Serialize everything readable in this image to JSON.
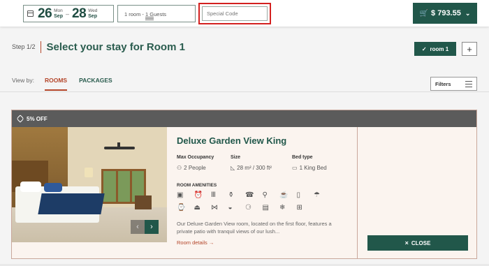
{
  "dates": {
    "checkin_day": "26",
    "checkin_weekday": "Mon",
    "checkin_month": "Sep",
    "separator": "–",
    "checkout_day": "28",
    "checkout_weekday": "Wed",
    "checkout_month": "Sep"
  },
  "guests": {
    "value": "1 room - 1 Guests"
  },
  "special_code": {
    "placeholder": "Special Code"
  },
  "cart": {
    "total": "$ 793.55"
  },
  "step": {
    "label": "Step 1/2",
    "title": "Select your stay for Room 1"
  },
  "room_selector": {
    "label": "room 1",
    "add_label": "+"
  },
  "view": {
    "label": "View by:",
    "tabs": [
      {
        "label": "ROOMS",
        "active": true
      },
      {
        "label": "PACKAGES",
        "active": false
      }
    ],
    "filters_label": "Filters"
  },
  "room_card": {
    "badge": "5% OFF",
    "title": "Deluxe Garden View King",
    "specs": [
      {
        "heading": "Max Occupancy",
        "value": "2 People",
        "icon": "person-icon"
      },
      {
        "heading": "Size",
        "value": "28 m² / 300 ft²",
        "icon": "ruler-icon"
      },
      {
        "heading": "Bed type",
        "value": "1 King Bed",
        "icon": "bed-icon"
      }
    ],
    "amenities_heading": "ROOM AMENITIES",
    "amenities": [
      "safe-icon",
      "alarm-clock-icon",
      "columns-icon",
      "bottles-icon",
      "phone-list-icon",
      "hairdryer-icon",
      "kettle-icon",
      "minibar-icon",
      "umbrella-icon",
      "alarm-icon",
      "iron-icon",
      "ironing-board-icon",
      "cushion-icon",
      "slippers-icon",
      "tv-icon",
      "ac-icon",
      "hangers-icon"
    ],
    "description": "Our Deluxe Garden View room, located on the first floor, features a private patio with tranquil views of our lush...",
    "details_link": "Room details →",
    "close_label": "CLOSE"
  },
  "colors": {
    "brand_green": "#21574a",
    "accent_rust": "#b4462a",
    "highlight_red": "#d3201f"
  }
}
